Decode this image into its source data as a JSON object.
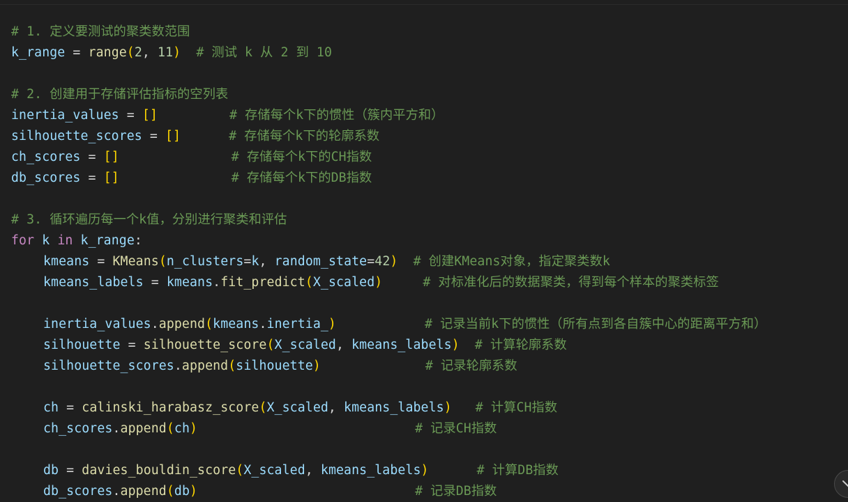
{
  "lines": {
    "l1": {
      "comment": "# 1. 定义要测试的聚类数范围"
    },
    "l2": {
      "var": "k_range",
      "op": "=",
      "func": "range",
      "n1": "2",
      "n2": "11",
      "comment": "# 测试 k 从 2 到 10"
    },
    "l4": {
      "comment": "# 2. 创建用于存储评估指标的空列表"
    },
    "l5": {
      "var": "inertia_values",
      "comment": "# 存储每个k下的惯性（簇内平方和）"
    },
    "l6": {
      "var": "silhouette_scores",
      "comment": "# 存储每个k下的轮廓系数"
    },
    "l7": {
      "var": "ch_scores",
      "comment": "# 存储每个k下的CH指数"
    },
    "l8": {
      "var": "db_scores",
      "comment": "# 存储每个k下的DB指数"
    },
    "l10": {
      "comment": "# 3. 循环遍历每一个k值，分别进行聚类和评估"
    },
    "l11": {
      "kw_for": "for",
      "var": "k",
      "kw_in": "in",
      "iter": "k_range"
    },
    "l12": {
      "var": "kmeans",
      "func": "KMeans",
      "arg1": "n_clusters",
      "arg1v": "k",
      "arg2": "random_state",
      "arg2v": "42",
      "comment": "# 创建KMeans对象，指定聚类数k"
    },
    "l13": {
      "var": "kmeans_labels",
      "obj": "kmeans",
      "method": "fit_predict",
      "arg": "X_scaled",
      "comment": "# 对标准化后的数据聚类，得到每个样本的聚类标签"
    },
    "l15": {
      "obj": "inertia_values",
      "method": "append",
      "arg_obj": "kmeans",
      "arg_attr": "inertia_",
      "comment": "# 记录当前k下的惯性（所有点到各自簇中心的距离平方和）"
    },
    "l16": {
      "var": "silhouette",
      "func": "silhouette_score",
      "a1": "X_scaled",
      "a2": "kmeans_labels",
      "comment": "# 计算轮廓系数"
    },
    "l17": {
      "obj": "silhouette_scores",
      "method": "append",
      "arg": "silhouette",
      "comment": "# 记录轮廓系数"
    },
    "l19": {
      "var": "ch",
      "func": "calinski_harabasz_score",
      "a1": "X_scaled",
      "a2": "kmeans_labels",
      "comment": "# 计算CH指数"
    },
    "l20": {
      "obj": "ch_scores",
      "method": "append",
      "arg": "ch",
      "comment": "# 记录CH指数"
    },
    "l22": {
      "var": "db",
      "func": "davies_bouldin_score",
      "a1": "X_scaled",
      "a2": "kmeans_labels",
      "comment": "# 计算DB指数"
    },
    "l23": {
      "obj": "db_scores",
      "method": "append",
      "arg": "db",
      "comment": "# 记录DB指数"
    }
  },
  "syntax": {
    "op_assign": "=",
    "open": "(",
    "close": ")",
    "comma": ",",
    "dot": ".",
    "colon": ":",
    "empty_list": "[]"
  },
  "colors": {
    "background": "#1f1f1f",
    "comment": "#6a9955",
    "variable": "#9cdcfe",
    "function": "#dcdcaa",
    "number": "#b5cea8",
    "keyword": "#c586c0",
    "bracket": "#ffd700"
  },
  "icons": {
    "scroll_button": "chevron-down-icon"
  }
}
